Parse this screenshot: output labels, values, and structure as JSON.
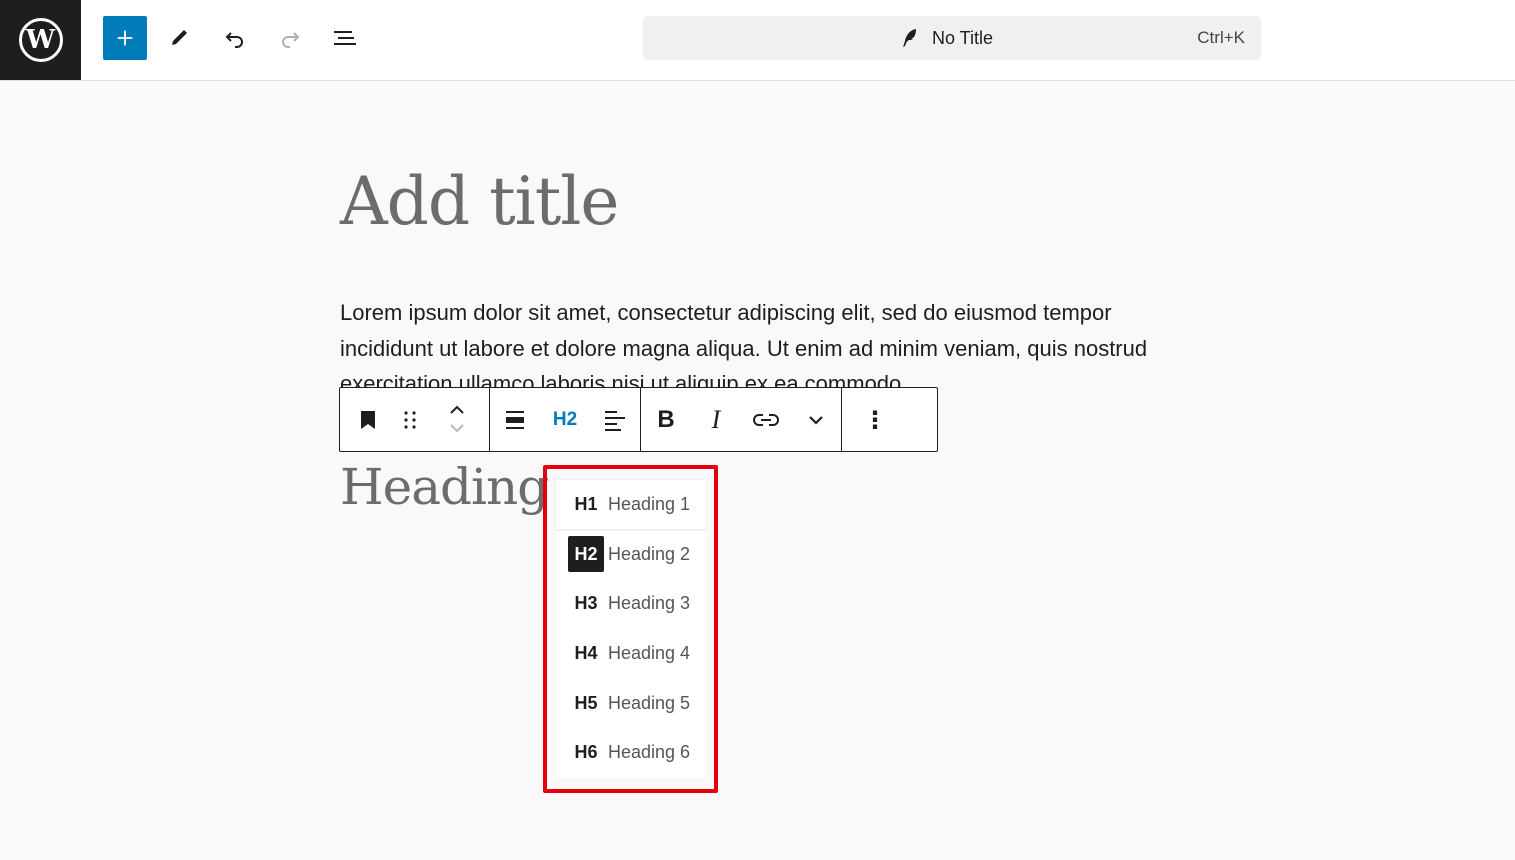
{
  "header": {
    "add_block_label": "+",
    "document_title": "No Title",
    "shortcut": "Ctrl+K"
  },
  "editor": {
    "title_placeholder": "Add title",
    "paragraph": "Lorem ipsum dolor sit amet, consectetur adipiscing elit, sed do eiusmod tempor incididunt ut labore et dolore magna aliqua. Ut enim ad minim veniam, quis nostrud exercitation ullamco laboris nisi ut aliquip ex ea commodo",
    "heading_text": "Heading"
  },
  "block_toolbar": {
    "heading_level": "H2",
    "bold_label": "B",
    "italic_label": "I",
    "more_label": "⋮"
  },
  "heading_levels": [
    {
      "level": "H1",
      "label": "Heading 1"
    },
    {
      "level": "H2",
      "label": "Heading 2"
    },
    {
      "level": "H3",
      "label": "Heading 3"
    },
    {
      "level": "H4",
      "label": "Heading 4"
    },
    {
      "level": "H5",
      "label": "Heading 5"
    },
    {
      "level": "H6",
      "label": "Heading 6"
    }
  ],
  "colors": {
    "accent": "#007cba",
    "highlight": "#e6000e",
    "dark": "#1e1e1e"
  }
}
